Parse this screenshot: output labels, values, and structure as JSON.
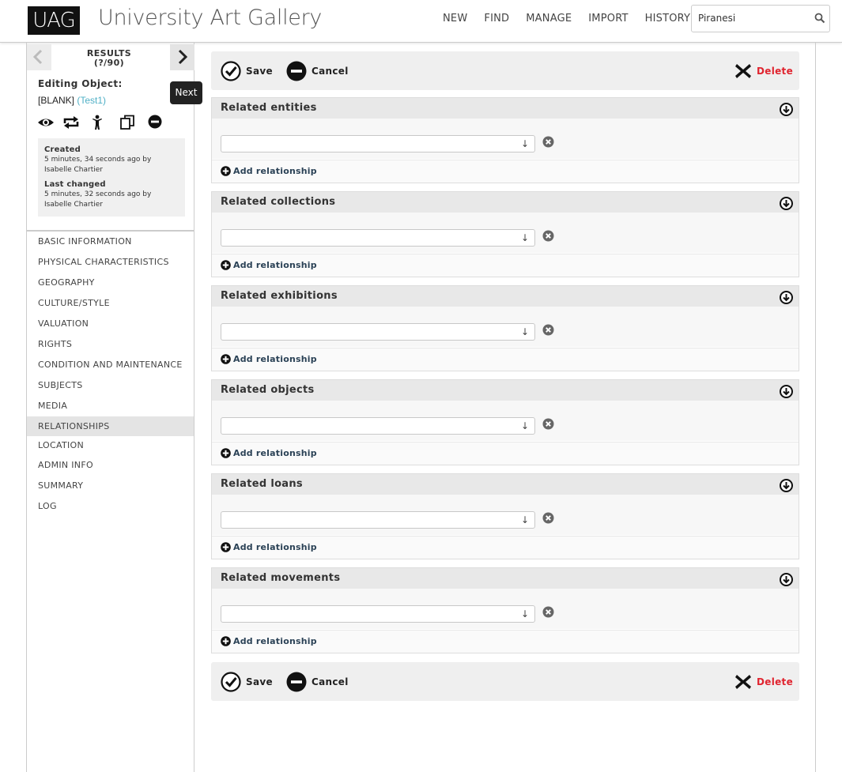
{
  "header": {
    "logo": "UAG",
    "app_title": "University Art Gallery",
    "nav": [
      "NEW",
      "FIND",
      "MANAGE",
      "IMPORT",
      "HISTORY"
    ],
    "search": {
      "value": "Piranesi"
    }
  },
  "sidebar": {
    "results_label": "RESULTS",
    "results_count": "(?/90)",
    "tooltip": "Next",
    "editing_label": "Editing Object:",
    "editing_value": "[BLANK]",
    "editing_link": "(Test1)",
    "created_label": "Created",
    "created_value": "5 minutes, 34 seconds ago by Isabelle Chartier",
    "changed_label": "Last changed",
    "changed_value": "5 minutes, 32 seconds ago by Isabelle Chartier",
    "menu": [
      "BASIC INFORMATION",
      "PHYSICAL CHARACTERISTICS",
      "GEOGRAPHY",
      "CULTURE/STYLE",
      "VALUATION",
      "RIGHTS",
      "CONDITION AND MAINTENANCE",
      "SUBJECTS",
      "MEDIA",
      "RELATIONSHIPS",
      "LOCATION",
      "ADMIN INFO",
      "SUMMARY",
      "LOG"
    ],
    "active_menu": "RELATIONSHIPS"
  },
  "actions": {
    "save": "Save",
    "cancel": "Cancel",
    "delete": "Delete"
  },
  "relationships": [
    {
      "title": "Related entities",
      "add_label": "Add relationship"
    },
    {
      "title": "Related collections",
      "add_label": "Add relationship"
    },
    {
      "title": "Related exhibitions",
      "add_label": "Add relationship"
    },
    {
      "title": "Related objects",
      "add_label": "Add relationship"
    },
    {
      "title": "Related loans",
      "add_label": "Add relationship"
    },
    {
      "title": "Related movements",
      "add_label": "Add relationship"
    }
  ],
  "colors": {
    "accent_link": "#4fb0c6",
    "delete": "#e0242f",
    "add_link": "#2b4256"
  }
}
